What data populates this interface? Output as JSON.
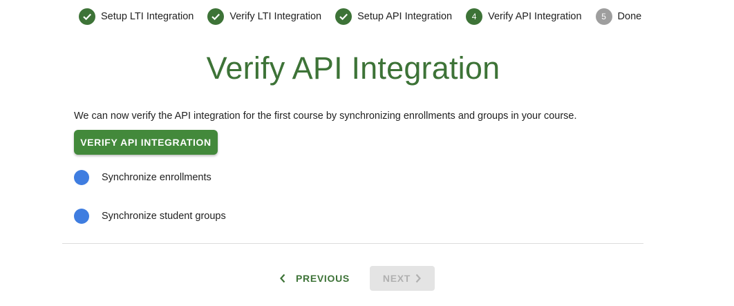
{
  "stepper": {
    "steps": [
      {
        "label": "Setup LTI Integration",
        "state": "done"
      },
      {
        "label": "Verify LTI Integration",
        "state": "done"
      },
      {
        "label": "Setup API Integration",
        "state": "done"
      },
      {
        "label": "Verify API Integration",
        "state": "active",
        "number": "4"
      },
      {
        "label": "Done",
        "state": "pending",
        "number": "5"
      }
    ]
  },
  "page": {
    "title": "Verify API Integration",
    "description": "We can now verify the API integration for the first course by synchronizing enrollments and groups in your course.",
    "verify_button": "VERIFY API INTEGRATION"
  },
  "tasks": [
    {
      "label": "Synchronize enrollments",
      "status_icon": "pending-dot-icon"
    },
    {
      "label": "Synchronize student groups",
      "status_icon": "pending-dot-icon"
    }
  ],
  "nav": {
    "previous_label": "PREVIOUS",
    "next_label": "NEXT",
    "next_disabled": true
  },
  "colors": {
    "primary_green": "#3d7337",
    "button_green": "#43893b",
    "pending_blue": "#3f7de0",
    "pending_gray": "#9e9e9e"
  }
}
